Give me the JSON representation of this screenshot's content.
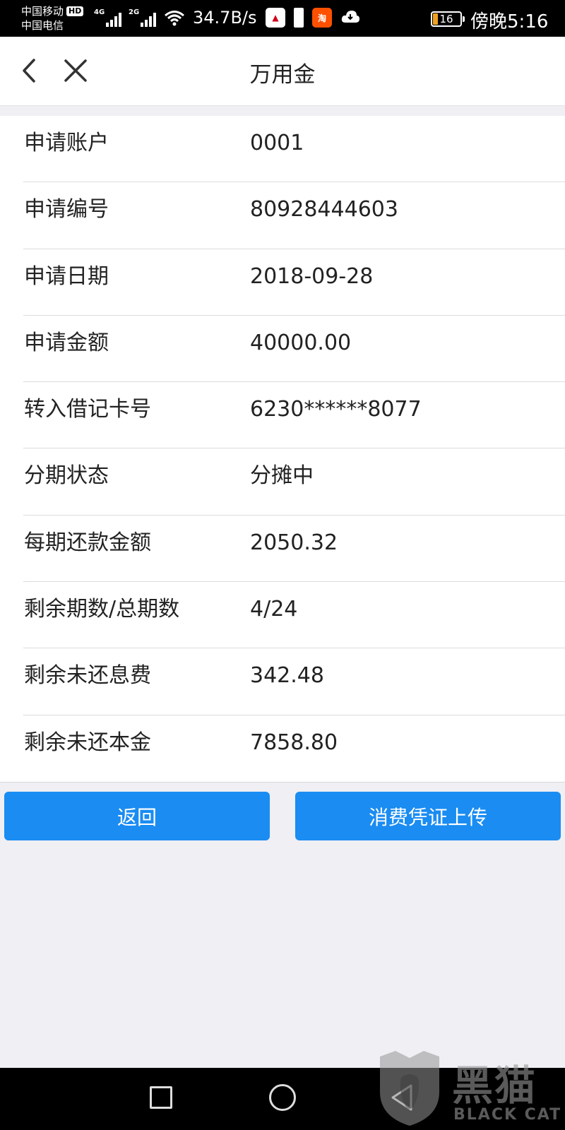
{
  "status_bar": {
    "carrier_1": "中国移动",
    "hd_badge": "HD",
    "carrier_2": "中国电信",
    "net_1": "4G",
    "net_2": "2G",
    "net_speed": "34.7B/s",
    "battery_level": "16",
    "time": "傍晚5:16"
  },
  "header": {
    "title": "万用金",
    "back_icon": "chevron-left-icon",
    "close_icon": "close-icon"
  },
  "details": [
    {
      "label": "申请账户",
      "value": "0001"
    },
    {
      "label": "申请编号",
      "value": "80928444603"
    },
    {
      "label": "申请日期",
      "value": "2018-09-28"
    },
    {
      "label": "申请金额",
      "value": "40000.00"
    },
    {
      "label": "转入借记卡号",
      "value": "6230******8077"
    },
    {
      "label": "分期状态",
      "value": "分摊中"
    },
    {
      "label": "每期还款金额",
      "value": "2050.32"
    },
    {
      "label": "剩余期数/总期数",
      "value": "4/24"
    },
    {
      "label": "剩余未还息费",
      "value": "342.48"
    },
    {
      "label": "剩余未还本金",
      "value": "7858.80"
    }
  ],
  "buttons": {
    "back_label": "返回",
    "upload_label": "消费凭证上传"
  },
  "watermark": {
    "text": "黑猫",
    "sub": "BLACK CAT"
  },
  "colors": {
    "primary_button": "#1a8cf2",
    "background": "#efeff4"
  }
}
